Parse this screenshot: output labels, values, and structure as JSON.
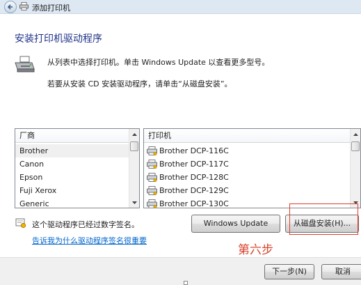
{
  "window": {
    "title": "添加打印机",
    "back_icon": "back-arrow-icon"
  },
  "heading": "安装打印机驱动程序",
  "description": {
    "line1": "从列表中选择打印机。单击 Windows Update 以查看更多型号。",
    "line2": "若要从安装 CD 安装驱动程序，请单击“从磁盘安装”。"
  },
  "manufacturer_list": {
    "header": "厂商",
    "items": [
      "Brother",
      "Canon",
      "Epson",
      "Fuji Xerox",
      "Generic"
    ],
    "selected": "Brother"
  },
  "printer_list": {
    "header": "打印机",
    "items": [
      "Brother DCP-116C",
      "Brother DCP-117C",
      "Brother DCP-128C",
      "Brother DCP-129C",
      "Brother DCP-130C"
    ]
  },
  "signature": {
    "text": "这个驱动程序已经过数字签名。",
    "link": "告诉我为什么驱动程序签名很重要"
  },
  "buttons": {
    "windows_update": "Windows Update",
    "have_disk": "从磁盘安装(H)...",
    "next": "下一步(N)",
    "cancel": "取消"
  },
  "annotation": {
    "text": "第六步",
    "color": "#d8452f"
  }
}
